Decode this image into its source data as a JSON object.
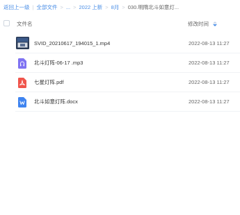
{
  "breadcrumb": {
    "back": "返回上一级",
    "root": "全部文件",
    "ellipsis": "...",
    "item1": "2022 上新",
    "item2": "8月",
    "current": "030.明隋北斗如意灯..."
  },
  "table": {
    "col_name": "文件名",
    "col_time": "修改时间"
  },
  "files": [
    {
      "name": "SVID_20210617_194015_1.mp4",
      "time": "2022-08-13 11:27",
      "icon": "video-thumbnail-icon"
    },
    {
      "name": "北斗灯阵-06-17 .mp3",
      "time": "2022-08-13 11:27",
      "icon": "audio-file-icon"
    },
    {
      "name": "七星灯阵.pdf",
      "time": "2022-08-13 11:27",
      "icon": "pdf-file-icon"
    },
    {
      "name": "北斗如意灯阵.docx",
      "time": "2022-08-13 11:27",
      "icon": "word-file-icon"
    }
  ],
  "colors": {
    "link": "#4a8ee6",
    "audio": "#7f73f2",
    "pdf": "#f0554c",
    "word": "#3f84f0"
  }
}
